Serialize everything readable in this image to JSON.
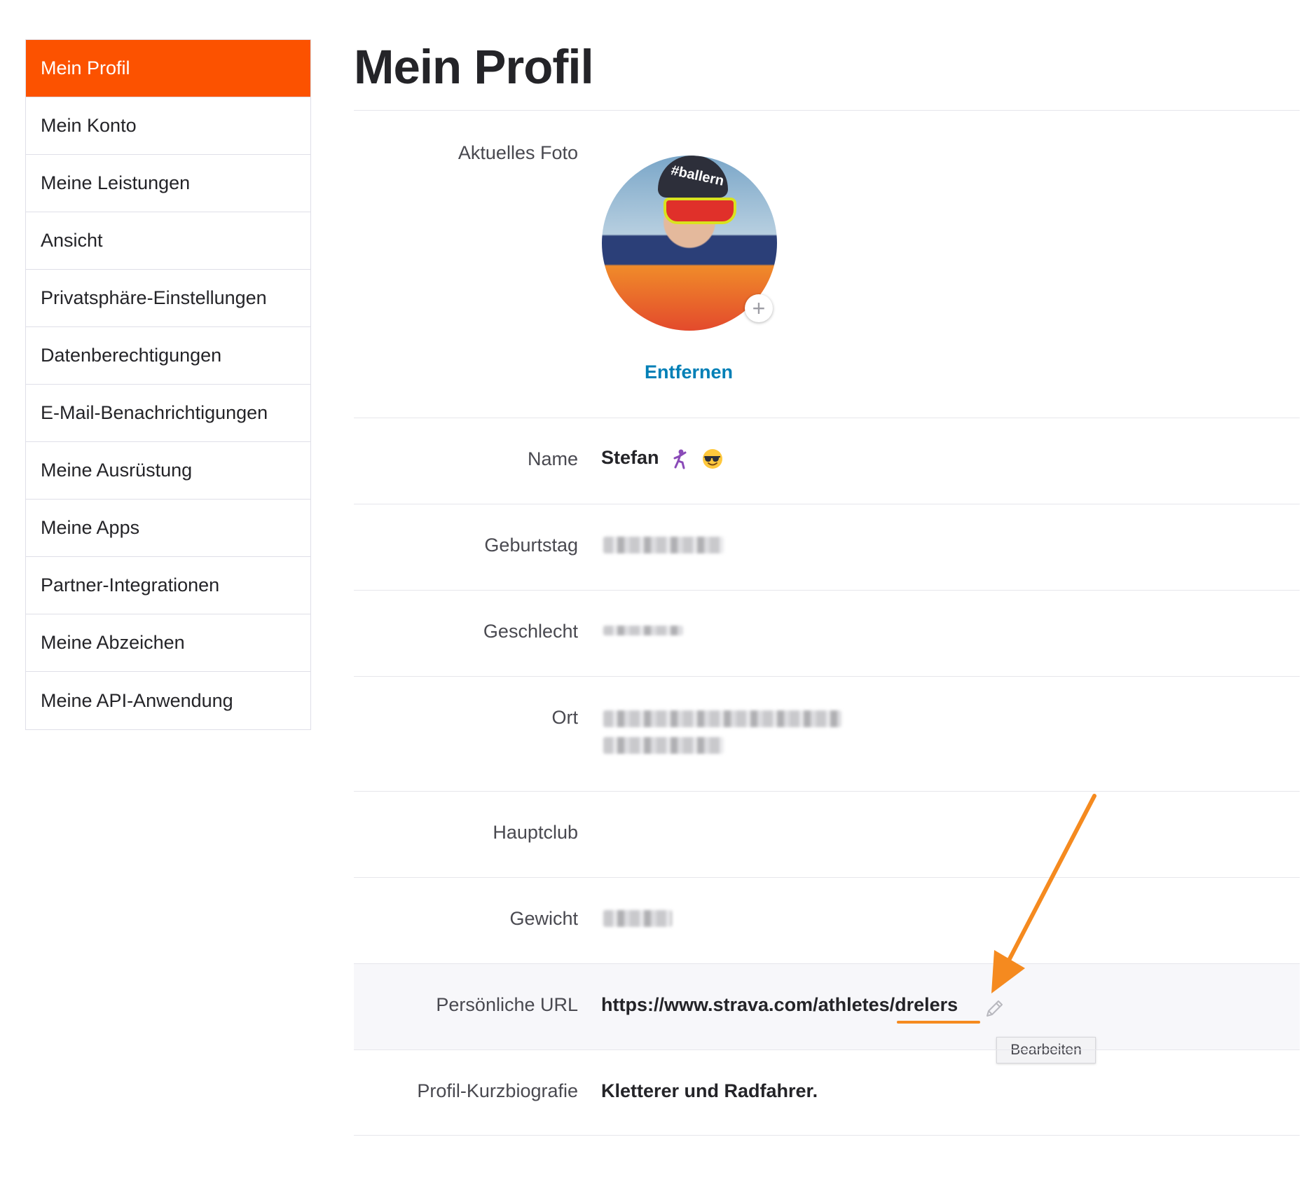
{
  "sidebar": {
    "items": [
      {
        "label": "Mein Profil",
        "active": true
      },
      {
        "label": "Mein Konto"
      },
      {
        "label": "Meine Leistungen"
      },
      {
        "label": "Ansicht"
      },
      {
        "label": "Privatsphäre-Einstellungen"
      },
      {
        "label": "Datenberechtigungen"
      },
      {
        "label": "E-Mail-Benachrichtigungen"
      },
      {
        "label": "Meine Ausrüstung"
      },
      {
        "label": "Meine Apps"
      },
      {
        "label": "Partner-Integrationen"
      },
      {
        "label": "Meine Abzeichen"
      },
      {
        "label": "Meine API-Anwendung"
      }
    ]
  },
  "main": {
    "title": "Mein Profil",
    "photo": {
      "label": "Aktuelles Foto",
      "helmet_text": "#ballern",
      "add_symbol": "+",
      "remove_label": "Entfernen"
    },
    "fields": {
      "name": {
        "label": "Name",
        "value": "Stefan"
      },
      "birthday": {
        "label": "Geburtstag"
      },
      "gender": {
        "label": "Geschlecht"
      },
      "location": {
        "label": "Ort"
      },
      "club": {
        "label": "Hauptclub",
        "value": ""
      },
      "weight": {
        "label": "Gewicht"
      },
      "url": {
        "label": "Persönliche URL",
        "value": "https://www.strava.com/athletes/drelers",
        "edit_tooltip": "Bearbeiten"
      },
      "bio": {
        "label": "Profil-Kurzbiografie",
        "value": "Kletterer und Radfahrer."
      }
    }
  },
  "colors": {
    "accent": "#fc5200",
    "link": "#007fb6",
    "annotation": "#f58a1f"
  },
  "icons": {
    "name_emojis": [
      "dancing-person-icon",
      "sunglasses-face-icon"
    ],
    "edit": "pencil-icon"
  }
}
